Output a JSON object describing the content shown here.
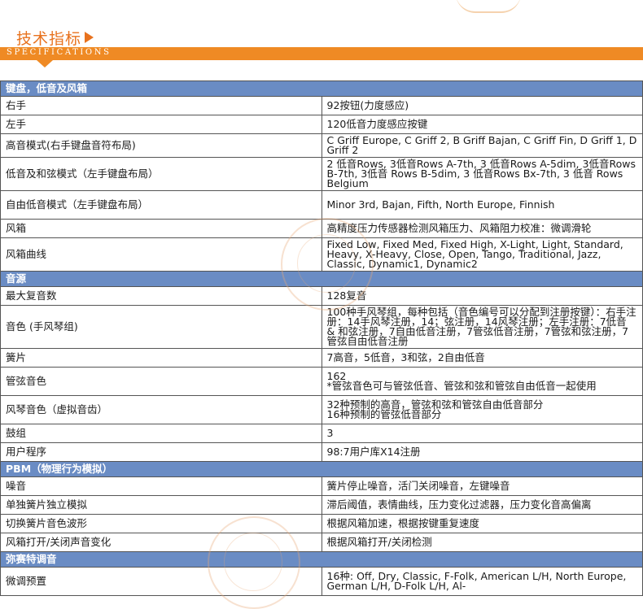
{
  "header": {
    "title": "技术指标",
    "subtitle": "SPECIFICATIONS"
  },
  "colors": {
    "accent": "#ef8a24",
    "section_bg": "#6a8cc4"
  },
  "sections": [
    {
      "title": "键盘，低音及风箱",
      "rows": [
        {
          "label": "右手",
          "value": "92按钮(力度感应)"
        },
        {
          "label": "左手",
          "value": "120低音力度感应按键"
        },
        {
          "label": "高音模式(右手键盘音符布局)",
          "value": "C Griff Europe, C Griff 2, B Griff Bajan, C Griff Fin, D Griff 1, D Griff 2"
        },
        {
          "label": "低音及和弦模式（左手键盘布局）",
          "value": "2 低音Rows, 3低音Rows A-7th, 3 低音Rows A-5dim, 3低音Rows B-7th, 3低音 Rows B-5dim, 3 低音Rows Bx-7th, 3 低音 Rows Belgium"
        },
        {
          "label": "自由低音模式（左手键盘布局）",
          "value": "Minor 3rd, Bajan, Fifth, North Europe, Finnish"
        },
        {
          "label": "风箱",
          "value": "高精度压力传感器检测风箱压力、风箱阻力校准：微调滑轮"
        },
        {
          "label": "风箱曲线",
          "value": "Fixed Low, Fixed Med, Fixed High, X-Light, Light, Standard, Heavy, X-Heavy, Close, Open, Tango, Traditional, Jazz, Classic, Dynamic1, Dynamic2"
        }
      ]
    },
    {
      "title": "音源",
      "rows": [
        {
          "label": "最大复音数",
          "value": "128复音"
        },
        {
          "label": "音色 (手风琴组)",
          "value": "100种手风琴组，每种包括（音色编号可以分配到注册按键）：右手注册：14手风琴注册，14；弦注册，14风琴注册；左手注册：7低音 & 和弦注册，7自由低音注册，7管弦低音注册，7管弦和弦注册，7管弦自由低音注册"
        },
        {
          "label": "簧片",
          "value": "7高音，5低音，3和弦，2自由低音"
        },
        {
          "label": "管弦音色",
          "value": "162\n*管弦音色可与管弦低音、管弦和弦和管弦自由低音一起使用"
        },
        {
          "label": "风琴音色（虚拟音齿）",
          "value": "32种预制的高音，管弦和弦和管弦自由低音部分\n16种预制的管弦低音部分"
        },
        {
          "label": "鼓组",
          "value": "3"
        },
        {
          "label": "用户程序",
          "value": "98:7用户库X14注册"
        }
      ]
    },
    {
      "title": "PBM（物理行为模拟）",
      "rows": [
        {
          "label": "噪音",
          "value": "簧片停止噪音，活门关闭噪音，左键噪音"
        },
        {
          "label": "单独簧片独立模拟",
          "value": "滞后阈值，表情曲线，压力变化过滤器，压力变化音高偏离"
        },
        {
          "label": "切换簧片音色波形",
          "value": "根据风箱加速，根据按键重复速度"
        },
        {
          "label": "风箱打开/关闭声音变化",
          "value": "根据风箱打开/关闭检测"
        }
      ]
    },
    {
      "title": "弥赛特调音",
      "rows": [
        {
          "label": "微调预置",
          "value": "16种: Off, Dry, Classic, F-Folk, American L/H, North Europe, German L/H, D-Folk L/H, Al-"
        }
      ]
    }
  ]
}
